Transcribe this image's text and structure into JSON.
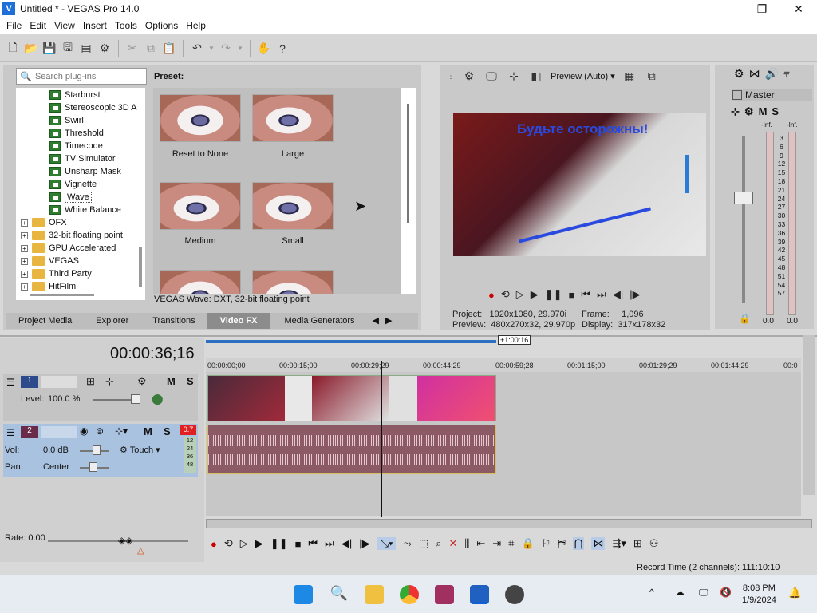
{
  "window": {
    "title": "Untitled * - VEGAS Pro 14.0",
    "minimize": "—",
    "maximize": "❐",
    "close": "✕"
  },
  "menu": [
    "File",
    "Edit",
    "View",
    "Insert",
    "Tools",
    "Options",
    "Help"
  ],
  "plugin_search": {
    "placeholder": "Search plug-ins"
  },
  "plugins": [
    {
      "label": "Starburst",
      "type": "fx"
    },
    {
      "label": "Stereoscopic 3D A",
      "type": "fx"
    },
    {
      "label": "Swirl",
      "type": "fx"
    },
    {
      "label": "Threshold",
      "type": "fx"
    },
    {
      "label": "Timecode",
      "type": "fx"
    },
    {
      "label": "TV Simulator",
      "type": "fx"
    },
    {
      "label": "Unsharp Mask",
      "type": "fx"
    },
    {
      "label": "Vignette",
      "type": "fx"
    },
    {
      "label": "Wave",
      "type": "fx",
      "selected": true
    },
    {
      "label": "White Balance",
      "type": "fx"
    },
    {
      "label": "OFX",
      "type": "folder"
    },
    {
      "label": "32-bit floating point",
      "type": "folder"
    },
    {
      "label": "GPU Accelerated",
      "type": "folder"
    },
    {
      "label": "VEGAS",
      "type": "folder"
    },
    {
      "label": "Third Party",
      "type": "folder"
    },
    {
      "label": "HitFilm",
      "type": "folder"
    }
  ],
  "preset": {
    "heading": "Preset:",
    "items": [
      "Reset to None",
      "Large",
      "Medium",
      "Small"
    ],
    "description": "VEGAS Wave: DXT, 32-bit floating point"
  },
  "window_tabs": [
    "Project Media",
    "Explorer",
    "Transitions",
    "Video FX",
    "Media Generators"
  ],
  "window_tabs_active": "Video FX",
  "preview": {
    "quality": "Preview (Auto)",
    "overlay_text": "Будьте осторожны!",
    "project_label": "Project:",
    "project_value": "1920x1080, 29.970i",
    "preview_label": "Preview:",
    "preview_value": "480x270x32, 29.970p",
    "frame_label": "Frame:",
    "frame_value": "1,096",
    "display_label": "Display:",
    "display_value": "317x178x32"
  },
  "mixer": {
    "title": "Master",
    "m": "M",
    "s": "S",
    "inf_left": "-Inf.",
    "inf_right": "-Inf.",
    "scale": [
      "3",
      "6",
      "9",
      "12",
      "15",
      "18",
      "21",
      "24",
      "27",
      "30",
      "33",
      "36",
      "39",
      "42",
      "45",
      "48",
      "51",
      "54",
      "57"
    ],
    "val_left": "0.0",
    "val_right": "0.0"
  },
  "timeline": {
    "timecode": "00:00:36;16",
    "loop_length": "+1:00:16",
    "ruler": [
      "00:00:00;00",
      "00:00:15;00",
      "00:00:29;29",
      "00:00:44;29",
      "00:00:59;28",
      "00:01:15;00",
      "00:01:29;29",
      "00:01:44;29",
      "00:0"
    ]
  },
  "track1": {
    "num": "1",
    "level_label": "Level:",
    "level_value": "100.0 %",
    "m": "M",
    "s": "S"
  },
  "track2": {
    "num": "2",
    "vol_label": "Vol:",
    "vol_value": "0.0 dB",
    "pan_label": "Pan:",
    "pan_value": "Center",
    "m": "M",
    "s": "S",
    "touch": "Touch",
    "peak": "0.7",
    "meter": [
      "12",
      "24",
      "36",
      "48"
    ]
  },
  "rate": {
    "label": "Rate:",
    "value": "0.00"
  },
  "status": {
    "record_time": "Record Time (2 channels): 111:10:10"
  },
  "taskbar": {
    "time": "8:08 PM",
    "date": "1/9/2024"
  }
}
